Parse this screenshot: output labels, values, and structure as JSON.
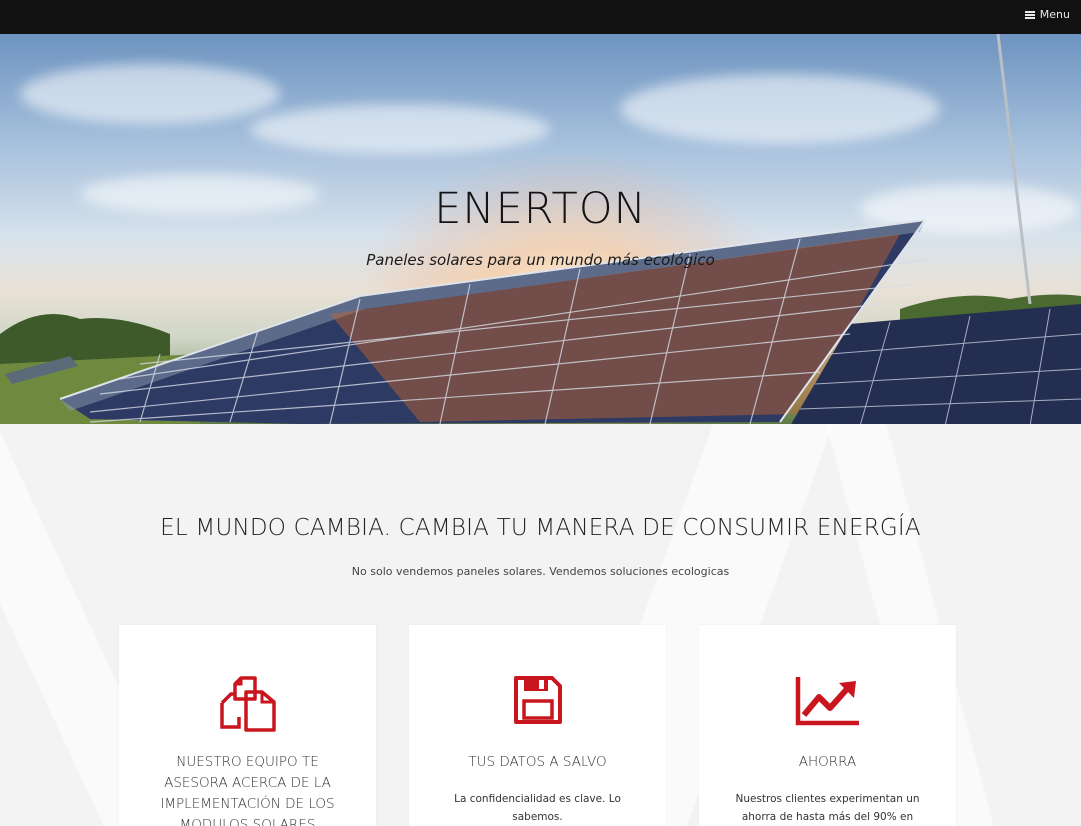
{
  "nav": {
    "menu_label": "Menu",
    "menu_icon": "hamburger-icon"
  },
  "hero": {
    "title": "ENERTON",
    "subtitle": "Paneles solares para un mundo más ecológico"
  },
  "intro": {
    "heading": "EL MUNDO CAMBIA. CAMBIA TU MANERA DE CONSUMIR ENERGÍA",
    "subheading": "No solo vendemos paneles solares. Vendemos soluciones ecologicas"
  },
  "features": [
    {
      "icon": "copy-files-icon",
      "title": "NUESTRO EQUIPO TE ASESORA ACERCA DE LA IMPLEMENTACIÓN DE LOS MODULOS SOLARES",
      "text": ""
    },
    {
      "icon": "floppy-disk-icon",
      "title": "TUS DATOS A SALVO",
      "text": "La confidencialidad es clave. Lo sabemos."
    },
    {
      "icon": "area-chart-icon",
      "title": "AHORRA",
      "text": "Nuestros clientes experimentan un ahorra de hasta más del 90% en"
    }
  ],
  "colors": {
    "accent": "#c9161e",
    "topbar": "#111111"
  }
}
